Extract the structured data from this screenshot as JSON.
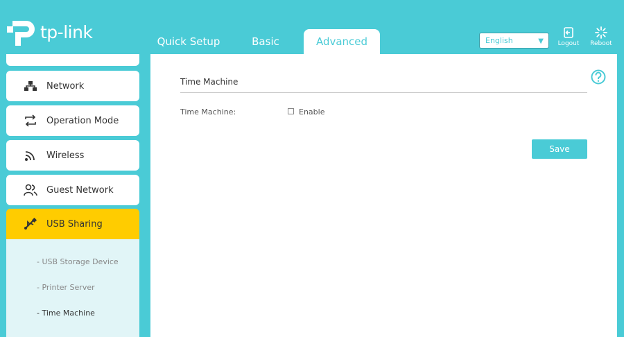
{
  "brand": {
    "name": "tp-link"
  },
  "tabs": [
    {
      "label": "Quick Setup"
    },
    {
      "label": "Basic"
    },
    {
      "label": "Advanced"
    }
  ],
  "header": {
    "language": "English",
    "logout_label": "Logout",
    "reboot_label": "Reboot"
  },
  "sidebar": {
    "items": [
      {
        "label": "Network",
        "icon": "network-icon"
      },
      {
        "label": "Operation Mode",
        "icon": "operation-mode-icon"
      },
      {
        "label": "Wireless",
        "icon": "wireless-icon"
      },
      {
        "label": "Guest Network",
        "icon": "guest-network-icon"
      },
      {
        "label": "USB Sharing",
        "icon": "usb-icon"
      }
    ],
    "subitems": [
      {
        "label": "- USB Storage Device"
      },
      {
        "label": "- Printer Server"
      },
      {
        "label": "- Time Machine"
      }
    ]
  },
  "main": {
    "section_title": "Time Machine",
    "field_label": "Time Machine:",
    "enable_label": "Enable",
    "enable_checked": false,
    "save_label": "Save"
  },
  "colors": {
    "accent": "#4acbd6",
    "active_nav": "#ffcc00"
  }
}
